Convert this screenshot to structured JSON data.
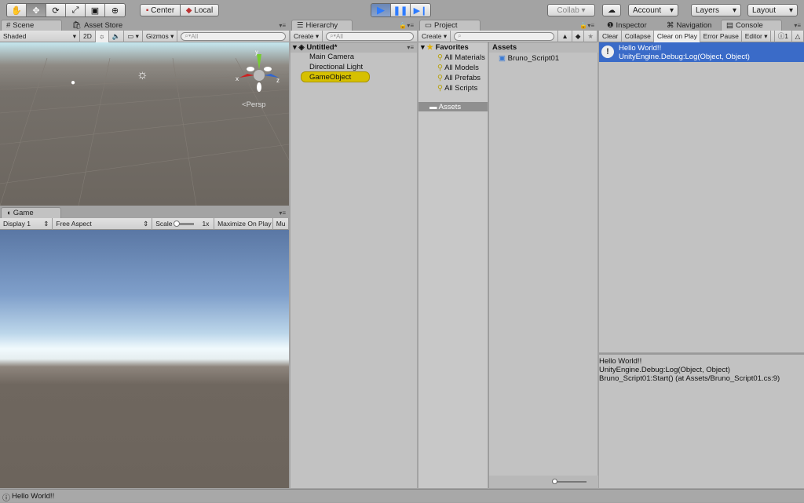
{
  "toolbar": {
    "tools": [
      "hand",
      "move",
      "rotate",
      "scale",
      "rect",
      "transform"
    ],
    "center": "Center",
    "local": "Local",
    "collab": "Collab ▾",
    "account": "Account",
    "layers": "Layers",
    "layout": "Layout"
  },
  "scene": {
    "tab": "Scene",
    "tab2": "Asset Store",
    "shading": "Shaded",
    "mode2d": "2D",
    "gizmos": "Gizmos",
    "search_placeholder": "All",
    "persp": "Persp",
    "axis_x": "x",
    "axis_y": "y",
    "axis_z": "z"
  },
  "game": {
    "tab": "Game",
    "display": "Display 1",
    "aspect": "Free Aspect",
    "scale_label": "Scale",
    "scale_value": "1x",
    "maximize": "Maximize On Play",
    "mute": "Mu"
  },
  "hierarchy": {
    "tab": "Hierarchy",
    "create": "Create",
    "search_placeholder": "All",
    "scene": "Untitled*",
    "items": [
      "Main Camera",
      "Directional Light",
      "GameObject"
    ],
    "selected": "GameObject",
    "highlight_color": "#d6c000"
  },
  "project": {
    "tab": "Project",
    "create": "Create",
    "favorites": "Favorites",
    "favorite_items": [
      "All Materials",
      "All Models",
      "All Prefabs",
      "All Scripts"
    ],
    "assets_folder": "Assets",
    "assets_header": "Assets",
    "files": [
      "Bruno_Script01"
    ]
  },
  "right": {
    "tabs": [
      "Inspector",
      "Navigation",
      "Console"
    ],
    "active": "Console"
  },
  "console": {
    "buttons": [
      "Clear",
      "Collapse",
      "Clear on Play",
      "Error Pause",
      "Editor ▾"
    ],
    "count": "1",
    "entries": [
      {
        "line1": "Hello World!!",
        "line2": "UnityEngine.Debug:Log(Object, Object)"
      }
    ],
    "detail": [
      "Hello World!!",
      "UnityEngine.Debug:Log(Object, Object)",
      "Bruno_Script01:Start() (at Assets/Bruno_Script01.cs:9)"
    ],
    "selected_color": "#3a6bc8"
  },
  "status": {
    "message": "Hello World!!"
  }
}
